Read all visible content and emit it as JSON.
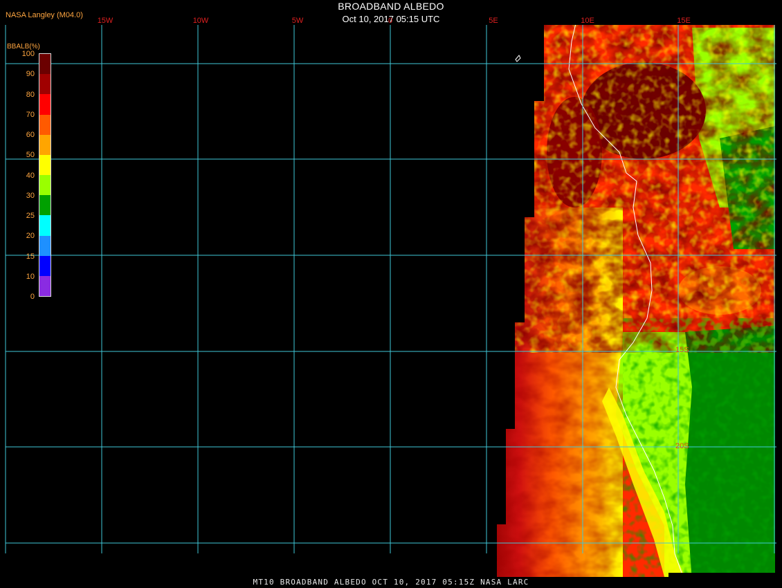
{
  "header": {
    "credit": "NASA Langley (M04.0)",
    "title": "BROADBAND ALBEDO",
    "subtitle": "Oct 10, 2017 05:15 UTC"
  },
  "footer": {
    "caption": "MT10  BROADBAND ALBEDO   OCT 10, 2017 05:15Z   NASA LARC"
  },
  "colorbar": {
    "title": "BBALB(%)",
    "ticks": [
      "100",
      "90",
      "80",
      "70",
      "60",
      "50",
      "40",
      "30",
      "25",
      "20",
      "15",
      "10",
      "0"
    ],
    "colors": [
      "#6b0000",
      "#a00000",
      "#ff0000",
      "#ff5a00",
      "#ffa500",
      "#ffff00",
      "#9aff00",
      "#00a000",
      "#00ffff",
      "#1e90ff",
      "#0000ff",
      "#8a2be2"
    ]
  },
  "grid": {
    "lon_labels": [
      "15W",
      "10W",
      "5W",
      "0",
      "5E",
      "10E",
      "15E"
    ],
    "lat_labels": [
      "15S",
      "20S"
    ],
    "line_color": "#40c8d8"
  },
  "map": {
    "coast_color": "#ffffff"
  }
}
